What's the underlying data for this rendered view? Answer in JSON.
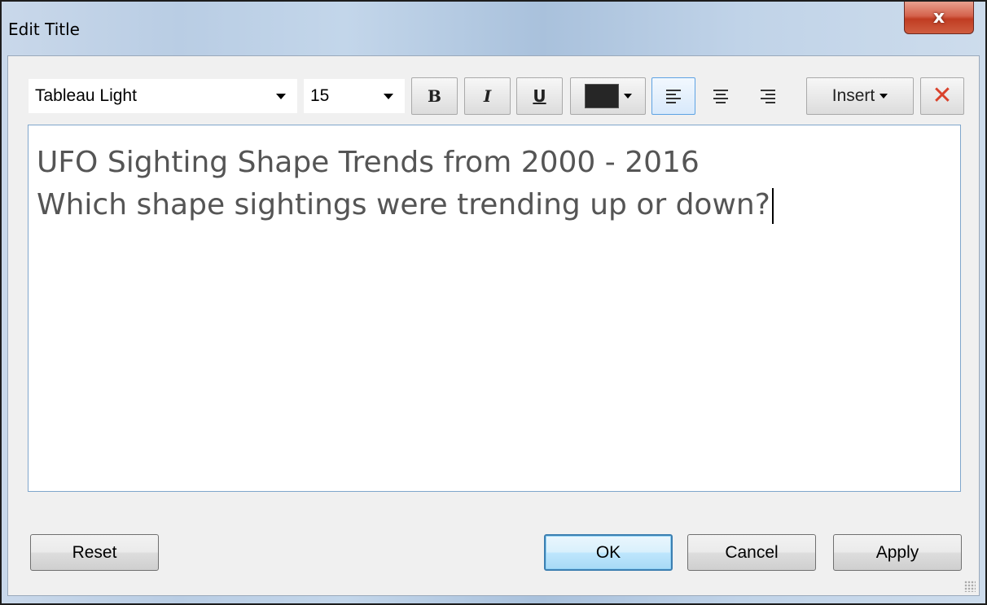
{
  "window": {
    "title": "Edit Title",
    "close_symbol": "x"
  },
  "toolbar": {
    "font_family": "Tableau Light",
    "font_size": "15",
    "bold_label": "B",
    "italic_label": "I",
    "underline_label": "U",
    "text_color": "#262626",
    "insert_label": "Insert",
    "clear_symbol": "✕"
  },
  "editor": {
    "line1": "UFO Sighting Shape Trends from 2000 - 2016",
    "line2": "Which shape sightings were trending up or down?"
  },
  "footer": {
    "reset_label": "Reset",
    "ok_label": "OK",
    "cancel_label": "Cancel",
    "apply_label": "Apply"
  }
}
